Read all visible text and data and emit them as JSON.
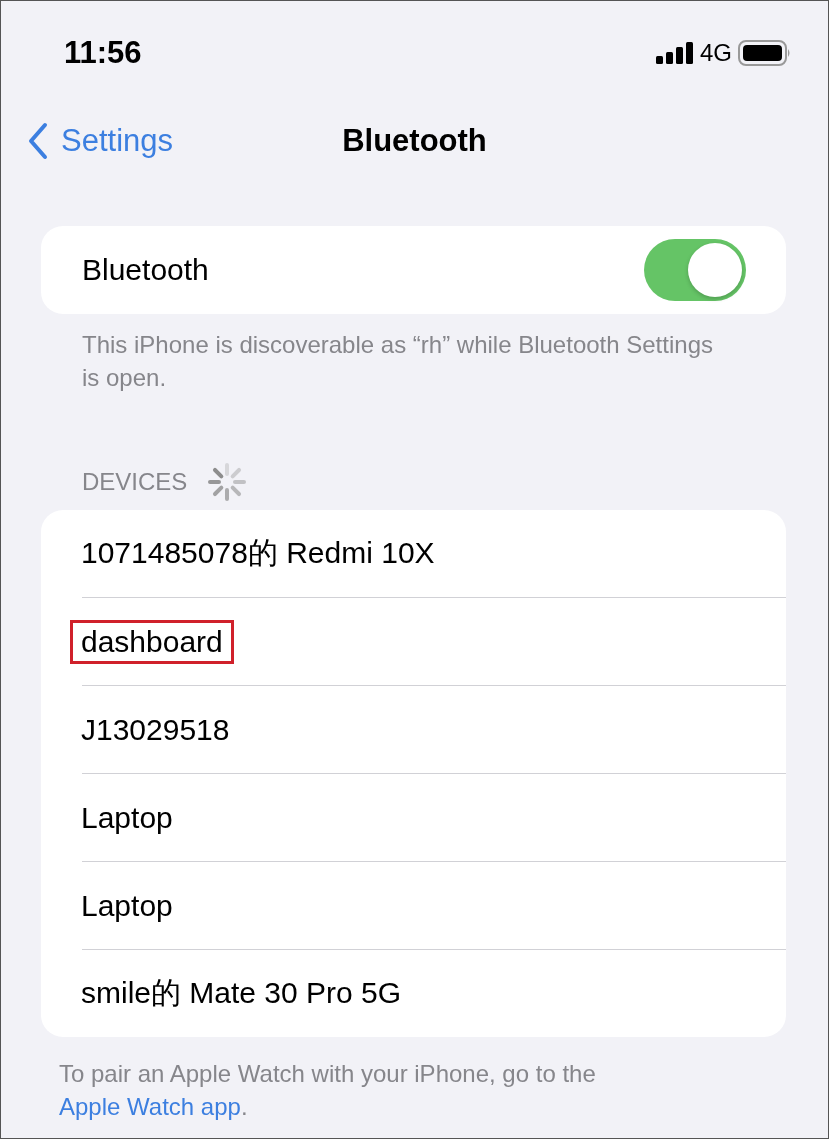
{
  "status_bar": {
    "time": "11:56",
    "network": "4G"
  },
  "nav": {
    "back": "Settings",
    "title": "Bluetooth"
  },
  "bluetooth": {
    "label": "Bluetooth",
    "on": true
  },
  "discoverable_note": "This iPhone is discoverable as “rh” while Bluetooth Settings is open.",
  "devices": {
    "header": "DEVICES",
    "scanning": true,
    "items": [
      {
        "name": "1071485078的 Redmi 10X",
        "highlighted": false
      },
      {
        "name": "dashboard",
        "highlighted": true
      },
      {
        "name": "J13029518",
        "highlighted": false
      },
      {
        "name": "Laptop",
        "highlighted": false
      },
      {
        "name": "Laptop",
        "highlighted": false
      },
      {
        "name": "smile的 Mate 30 Pro 5G",
        "highlighted": false
      }
    ]
  },
  "footer": {
    "text": "To pair an Apple Watch with your iPhone, go to the ",
    "link": "Apple Watch app",
    "end": "."
  }
}
